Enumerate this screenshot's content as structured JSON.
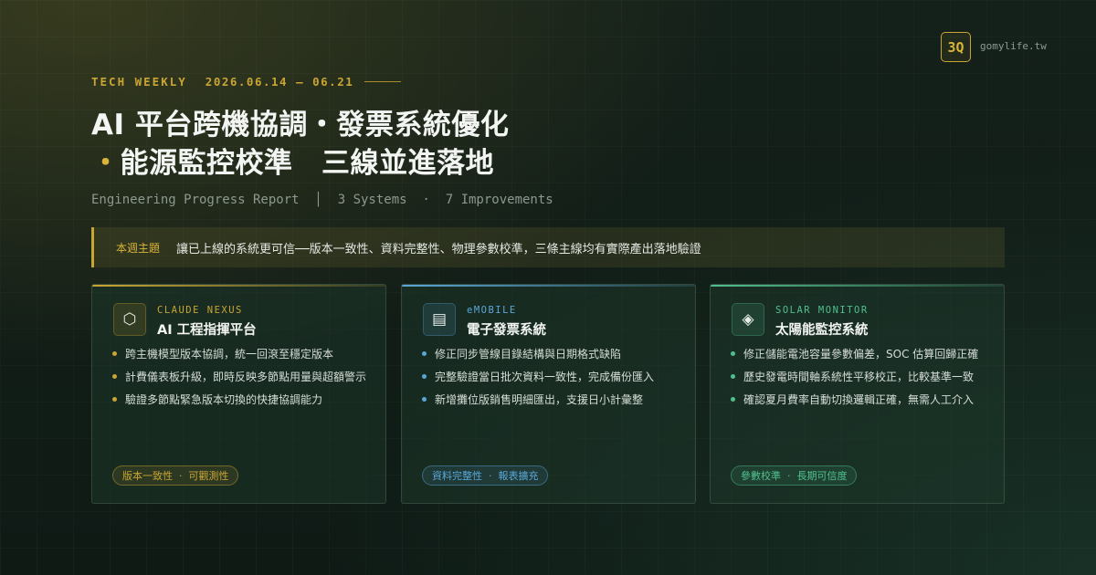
{
  "brand": {
    "logo": "3Q",
    "domain": "gomylife.tw",
    "accent": "#c9a533"
  },
  "header": {
    "eyebrow": "TECH WEEKLY",
    "date_range": "2026.06.14 – 06.21",
    "title_line1": "AI 平台跨機協調・發票系統優化",
    "title_line2_dot": "・",
    "title_line2": "能源監控校準　三線並進落地",
    "subtitle": "Engineering Progress Report  │  3 Systems  ·  7 Improvements"
  },
  "theme": {
    "label": "本週主題",
    "text": "讓已上線的系統更可信──版本一致性、資料完整性、物理參數校準，三條主線均有實際產出落地驗證"
  },
  "cards": [
    {
      "tag": "CLAUDE NEXUS",
      "name": "AI 工程指揮平台",
      "icon": "hexagon-icon",
      "icon_glyph": "⬡",
      "color": "#c9a533",
      "items": [
        "跨主機模型版本協調，統一回滾至穩定版本",
        "計費儀表板升級，即時反映多節點用量與超額警示",
        "驗證多節點緊急版本切換的快捷協調能力"
      ],
      "pill": "版本一致性  ·  可觀測性"
    },
    {
      "tag": "eMOBILE",
      "name": "電子發票系統",
      "icon": "document-icon",
      "icon_glyph": "▤",
      "color": "#5aa7d8",
      "items": [
        "修正同步管線目錄結構與日期格式缺陷",
        "完整驗證當日批次資料一致性，完成備份匯入",
        "新增攤位版銷售明細匯出，支援日小計彙整"
      ],
      "pill": "資料完整性  ·  報表擴充"
    },
    {
      "tag": "SOLAR MONITOR",
      "name": "太陽能監控系統",
      "icon": "diamond-icon",
      "icon_glyph": "◈",
      "color": "#4fc08d",
      "items": [
        "修正儲能電池容量參數偏差，SOC 估算回歸正確",
        "歷史發電時間軸系統性平移校正，比較基準一致",
        "確認夏月費率自動切換邏輯正確，無需人工介入"
      ],
      "pill": "參數校準  ·  長期可信度"
    }
  ]
}
